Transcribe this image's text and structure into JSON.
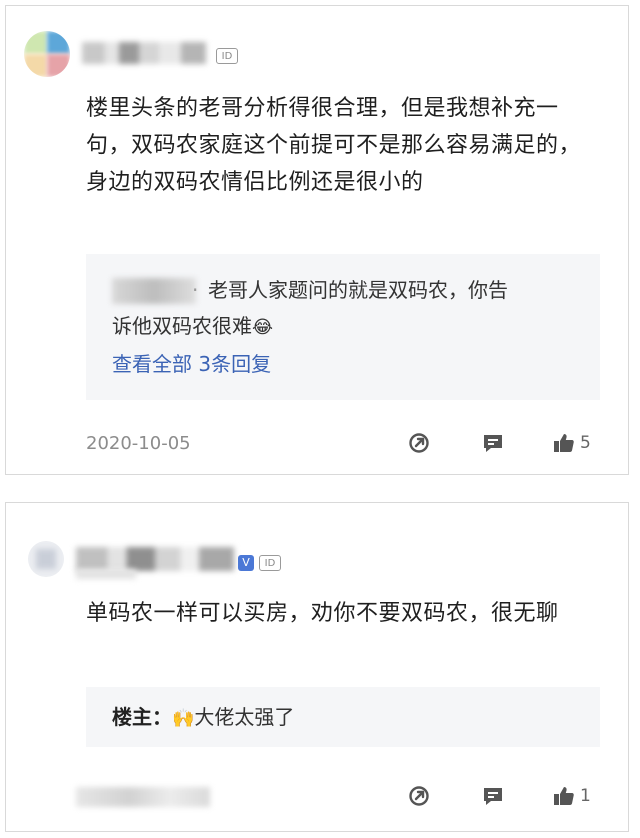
{
  "post1": {
    "id_badge": "ID",
    "content": "楼里头条的老哥分析得很合理，但是我想补充一句，双码农家庭这个前提可不是那么容易满足的，身边的双码农情侣比例还是很小的",
    "reply": {
      "separator": "·",
      "text_line1": "老哥人家题问的就是双码农，你告",
      "text_line2": "诉他双码农很难",
      "emoji": "😂",
      "more_link": "查看全部 3条回复"
    },
    "date": "2020-10-05",
    "like_count": "5"
  },
  "post2": {
    "vip_badge": "V",
    "id_badge": "ID",
    "content": "单码农一样可以买房，劝你不要双码农，很无聊",
    "reply": {
      "author": "楼主：",
      "emoji": "🙌",
      "text": "大佬太强了"
    },
    "like_count": "1"
  },
  "colors": {
    "link": "#3b63b5",
    "vip": "#4b78d6",
    "reply_bg": "#f5f6f8"
  },
  "icons": [
    "share-icon",
    "comment-icon",
    "thumbs-up-icon"
  ]
}
